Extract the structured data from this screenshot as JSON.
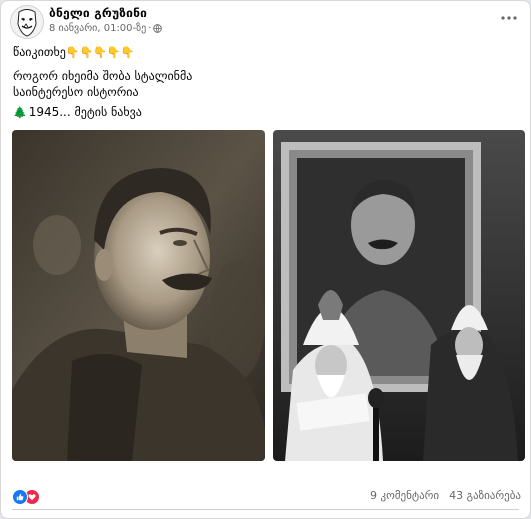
{
  "post": {
    "author": "ბნელი გრუზინი",
    "date": "8 იანვარი, 01:00-ზე",
    "separator": "·",
    "lines": {
      "line1_text": "წაიკითხე",
      "line1_emoji": "👇👇👇👇👇",
      "line2": "როგორ  იხეიმა შობა სტალინმა",
      "line3": "საინტერესო ისტორია",
      "line4_tree": "🌲",
      "line4_text": "1945...",
      "see_more": "მეტის ნახვა"
    },
    "icons": {
      "avatar": "mask-avatar-icon",
      "privacy": "globe-icon",
      "menu": "more-options-icon",
      "like": "like-icon",
      "love": "love-icon"
    },
    "photos": [
      {
        "name": "photo-stalin-portrait"
      },
      {
        "name": "photo-stalin-with-clergy"
      }
    ],
    "footer": {
      "comments": "9 კომენტარი",
      "shares": "43 გაზიარება"
    },
    "colors": {
      "author": "#050505",
      "meta": "#65676b",
      "like": "#1877f2",
      "love": "#f0284a"
    }
  }
}
